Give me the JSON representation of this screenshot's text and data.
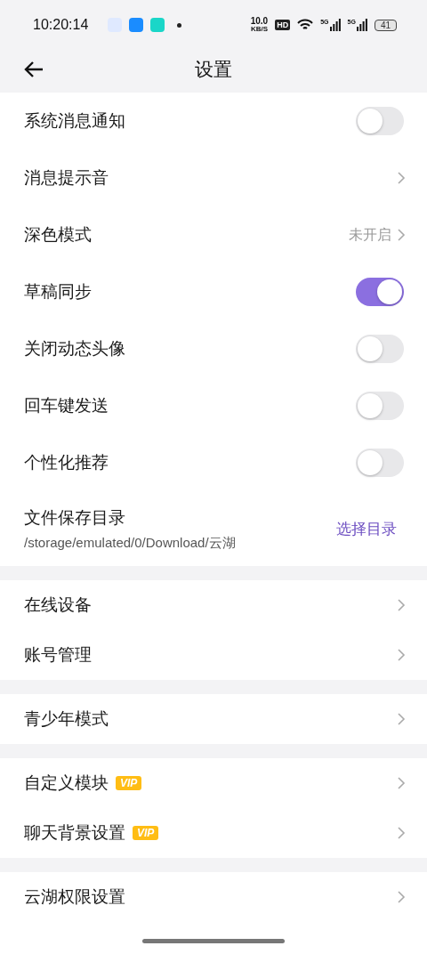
{
  "status_bar": {
    "time": "10:20:14",
    "net_speed": "10.0",
    "net_unit": "KB/S",
    "hd": "HD",
    "signals": [
      "5G",
      "5G"
    ],
    "battery": "41"
  },
  "header": {
    "title": "设置"
  },
  "groups": [
    {
      "rows": [
        {
          "kind": "toggle",
          "label": "系统消息通知",
          "on": false
        },
        {
          "kind": "link",
          "label": "消息提示音"
        },
        {
          "kind": "link",
          "label": "深色模式",
          "value": "未开启"
        },
        {
          "kind": "toggle",
          "label": "草稿同步",
          "on": true
        },
        {
          "kind": "toggle",
          "label": "关闭动态头像",
          "on": false
        },
        {
          "kind": "toggle",
          "label": "回车键发送",
          "on": false
        },
        {
          "kind": "toggle",
          "label": "个性化推荐",
          "on": false
        },
        {
          "kind": "folder",
          "label": "文件保存目录",
          "path": "/storage/emulated/0/Download/云湖",
          "action": "选择目录"
        }
      ]
    },
    {
      "rows": [
        {
          "kind": "link",
          "label": "在线设备"
        },
        {
          "kind": "link",
          "label": "账号管理"
        }
      ]
    },
    {
      "rows": [
        {
          "kind": "link",
          "label": "青少年模式"
        }
      ]
    },
    {
      "rows": [
        {
          "kind": "link",
          "label": "自定义模块",
          "badge": "VIP"
        },
        {
          "kind": "link",
          "label": "聊天背景设置",
          "badge": "VIP"
        }
      ]
    },
    {
      "rows": [
        {
          "kind": "link",
          "label": "云湖权限设置"
        }
      ]
    }
  ]
}
